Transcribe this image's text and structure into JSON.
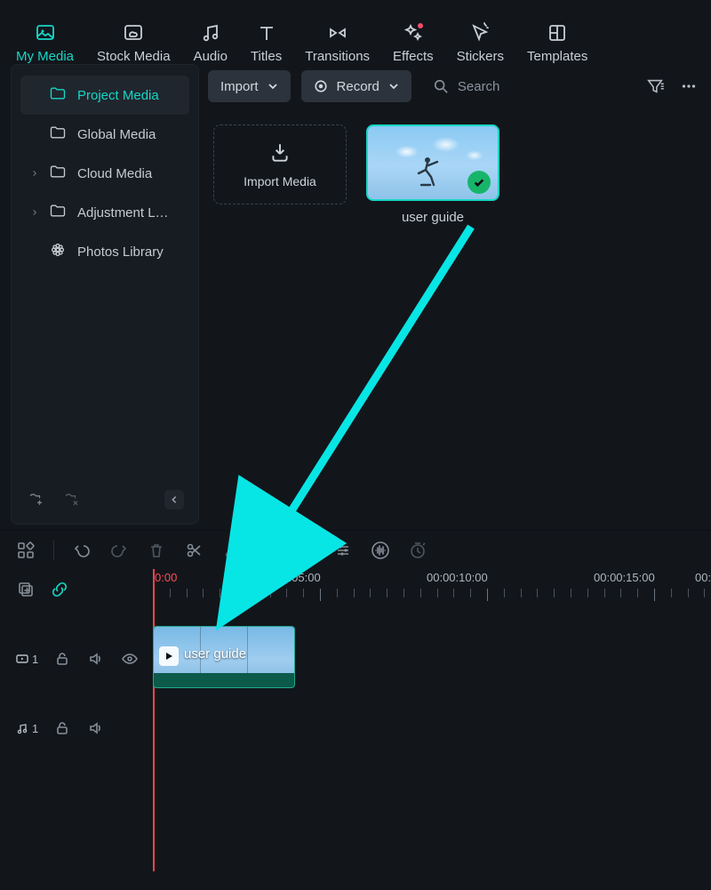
{
  "tabs": {
    "my_media": "My Media",
    "stock_media": "Stock Media",
    "audio": "Audio",
    "titles": "Titles",
    "transitions": "Transitions",
    "effects": "Effects",
    "stickers": "Stickers",
    "templates": "Templates"
  },
  "sidebar": {
    "project_media": "Project Media",
    "global_media": "Global Media",
    "cloud_media": "Cloud Media",
    "adjustment_layers": "Adjustment L…",
    "photos_library": "Photos Library"
  },
  "mp": {
    "import_btn": "Import",
    "record_btn": "Record",
    "search_placeholder": "Search",
    "import_tile": "Import Media"
  },
  "clip": {
    "name": "user guide"
  },
  "ruler": {
    "t0": "0:00",
    "t5": "00:00:05:00",
    "t10": "00:00:10:00",
    "t15": "00:00:15:00",
    "t20": "00:"
  },
  "track": {
    "video_num": "1",
    "audio_num": "1",
    "clip_label": "user guide"
  }
}
